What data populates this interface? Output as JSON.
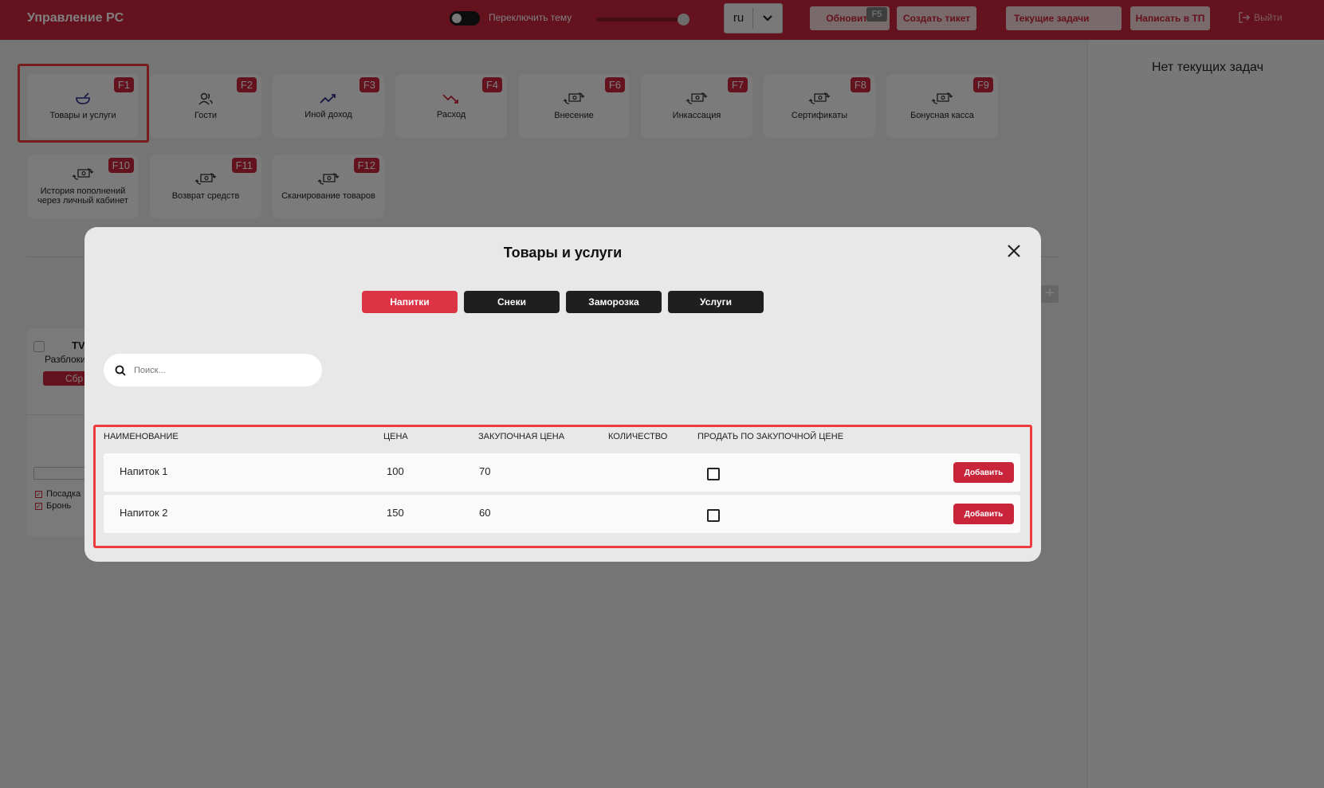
{
  "header": {
    "title": "Управление PC",
    "theme_label": "Переключить тему",
    "language": "ru",
    "refresh_label": "Обновить",
    "refresh_hotkey": "F5",
    "create_ticket_label": "Создать тикет",
    "current_tasks_label": "Текущие задачи",
    "write_support_label": "Написать в ТП",
    "logout_label": "Выйти"
  },
  "tiles": [
    {
      "label": "Товары и услуги",
      "key": "F1",
      "icon": "bowl-icon"
    },
    {
      "label": "Гости",
      "key": "F2",
      "icon": "users-icon"
    },
    {
      "label": "Иной доход",
      "key": "F3",
      "icon": "trend-up-icon"
    },
    {
      "label": "Расход",
      "key": "F4",
      "icon": "trend-down-icon"
    },
    {
      "label": "Внесение",
      "key": "F6",
      "icon": "cash-exchange-icon"
    },
    {
      "label": "Инкассация",
      "key": "F7",
      "icon": "cash-exchange-icon"
    },
    {
      "label": "Сертификаты",
      "key": "F8",
      "icon": "cash-exchange-icon"
    },
    {
      "label": "Бонусная касса",
      "key": "F9",
      "icon": "cash-exchange-icon"
    },
    {
      "label": "История пополнений через личный кабинет",
      "key": "F10",
      "icon": "cash-exchange-icon"
    },
    {
      "label": "Возврат средств",
      "key": "F11",
      "icon": "cash-exchange-icon"
    },
    {
      "label": "Сканирование товаров",
      "key": "F12",
      "icon": "cash-exchange-icon"
    }
  ],
  "right_panel": {
    "no_tasks": "Нет текущих задач"
  },
  "background_card": {
    "title": "TV",
    "subtitle": "Разблоки",
    "reset": "Сбр",
    "checkbox_landing": "Посадка",
    "checkbox_booking": "Бронь"
  },
  "modal": {
    "title": "Товары и услуги",
    "categories": [
      {
        "label": "Напитки",
        "active": true
      },
      {
        "label": "Снеки",
        "active": false
      },
      {
        "label": "Заморозка",
        "active": false
      },
      {
        "label": "Услуги",
        "active": false
      }
    ],
    "search_placeholder": "Поиск...",
    "columns": {
      "name": "НАИМЕНОВАНИЕ",
      "price": "ЦЕНА",
      "purchase_price": "ЗАКУПОЧНАЯ ЦЕНА",
      "quantity": "КОЛИЧЕСТВО",
      "sell_at_purchase": "ПРОДАТЬ ПО ЗАКУПОЧНОЙ ЦЕНЕ"
    },
    "rows": [
      {
        "name": "Напиток 1",
        "price": "100",
        "purchase_price": "70",
        "add_label": "Добавить"
      },
      {
        "name": "Напиток 2",
        "price": "150",
        "purchase_price": "60",
        "add_label": "Добавить"
      }
    ]
  },
  "colors": {
    "brand": "#c8243a",
    "dark_tab": "#1f1f1f",
    "highlight": "#ef3b3b"
  }
}
